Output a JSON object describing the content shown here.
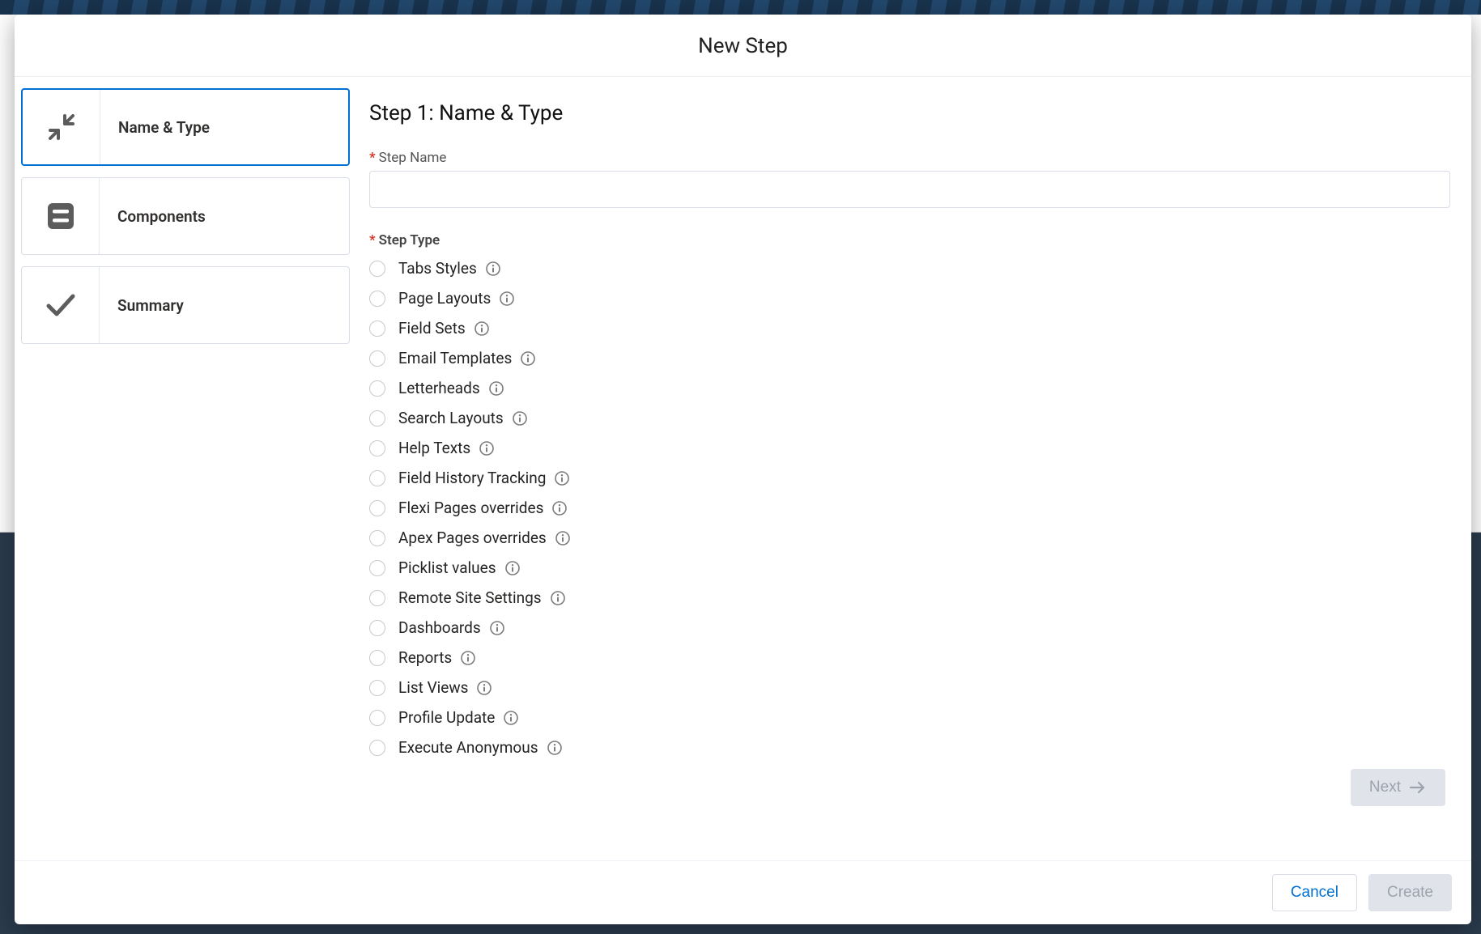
{
  "modal": {
    "title": "New Step"
  },
  "wizard": {
    "items": [
      {
        "id": "name-type",
        "label": "Name & Type",
        "iconHint": "collapse-icon",
        "active": true
      },
      {
        "id": "components",
        "label": "Components",
        "iconHint": "list-icon",
        "active": false
      },
      {
        "id": "summary",
        "label": "Summary",
        "iconHint": "check-icon",
        "active": false
      }
    ]
  },
  "form": {
    "heading": "Step 1: Name & Type",
    "step_name_label": "Step Name",
    "step_name_value": "",
    "step_type_label": "Step Type",
    "step_types": [
      {
        "label": "Tabs Styles"
      },
      {
        "label": "Page Layouts"
      },
      {
        "label": "Field Sets"
      },
      {
        "label": "Email Templates"
      },
      {
        "label": "Letterheads"
      },
      {
        "label": "Search Layouts"
      },
      {
        "label": "Help Texts"
      },
      {
        "label": "Field History Tracking"
      },
      {
        "label": "Flexi Pages overrides"
      },
      {
        "label": "Apex Pages overrides"
      },
      {
        "label": "Picklist values"
      },
      {
        "label": "Remote Site Settings"
      },
      {
        "label": "Dashboards"
      },
      {
        "label": "Reports"
      },
      {
        "label": "List Views"
      },
      {
        "label": "Profile Update"
      },
      {
        "label": "Execute Anonymous"
      }
    ],
    "next_label": "Next"
  },
  "footer": {
    "cancel_label": "Cancel",
    "create_label": "Create"
  }
}
